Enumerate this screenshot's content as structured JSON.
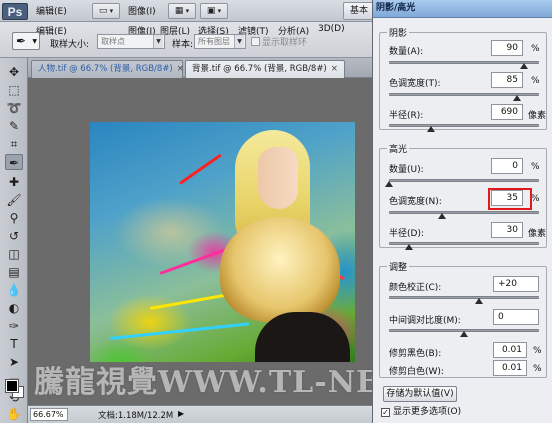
{
  "app": {
    "logo": "Ps",
    "workspace": "基本"
  },
  "menu": [
    "编辑(E)",
    "图像(I)",
    "图层(L)",
    "选择(S)",
    "滤镜(T)",
    "分析(A)",
    "3D(D)"
  ],
  "menubar_buttons": [
    {
      "icon": "frame-view-icon",
      "label": "▭"
    },
    {
      "icon": "arrange-docs-icon",
      "label": "▦"
    },
    {
      "icon": "screen-mode-icon",
      "label": "▣"
    }
  ],
  "options_bar": {
    "sample_size_label": "取样大小:",
    "sample_size_value": "取样点",
    "sample_label": "样本:",
    "sample_value": "所有图层",
    "show_ring_label": "显示取样环"
  },
  "tabs": [
    {
      "label": "人物.tif @ 66.7% (背景, RGB/8#)",
      "close": "×"
    },
    {
      "label": "背景.tif @ 66.7% (背景, RGB/8#)",
      "close": "×"
    }
  ],
  "status": {
    "zoom": "66.67%",
    "doc_info": "文档:1.18M/12.2M",
    "arrow": "▶"
  },
  "watermark": "騰龍視覺WWW.TL-NET",
  "dialog": {
    "title": "阴影/高光",
    "shadows": {
      "title": "阴影",
      "amount": {
        "label": "数量(A):",
        "value": "90",
        "unit": "%",
        "slider": 0.9
      },
      "tonal_width": {
        "label": "色调宽度(T):",
        "value": "85",
        "unit": "%",
        "slider": 0.85
      },
      "radius": {
        "label": "半径(R):",
        "value": "690",
        "unit": "像素",
        "slider": 0.28
      }
    },
    "highlights": {
      "title": "高光",
      "amount": {
        "label": "数量(U):",
        "value": "0",
        "unit": "%",
        "slider": 0.0
      },
      "tonal_width": {
        "label": "色调宽度(N):",
        "value": "35",
        "unit": "%",
        "slider": 0.35
      },
      "radius": {
        "label": "半径(D):",
        "value": "30",
        "unit": "像素",
        "slider": 0.13
      }
    },
    "adjustments": {
      "title": "调整",
      "color_correction": {
        "label": "颜色校正(C):",
        "value": "+20",
        "slider": 0.6
      },
      "midtone_contrast": {
        "label": "中间调对比度(M):",
        "value": "0",
        "slider": 0.5
      },
      "black_clip": {
        "label": "修剪黑色(B):",
        "value": "0.01",
        "unit": "%"
      },
      "white_clip": {
        "label": "修剪白色(W):",
        "value": "0.01",
        "unit": "%"
      }
    },
    "save_default": "存储为默认值(V)",
    "show_more": "显示更多选项(O)",
    "show_more_checked": true
  },
  "colors": {
    "foreground": "#000000",
    "background": "#ffffff",
    "highlight_box": "#e1191d",
    "title_bar": "#8fb5df"
  }
}
